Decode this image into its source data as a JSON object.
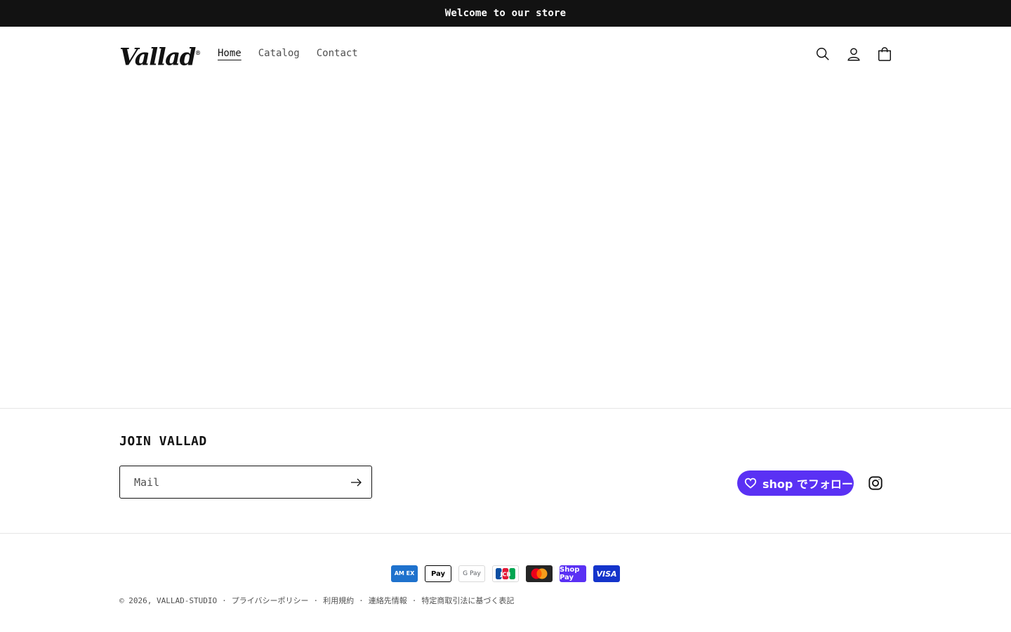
{
  "announcement": {
    "text": "Welcome to our store"
  },
  "header": {
    "logo_text": "Vallad",
    "logo_mark": "®",
    "nav": [
      {
        "label": "Home",
        "active": true
      },
      {
        "label": "Catalog",
        "active": false
      },
      {
        "label": "Contact",
        "active": false
      }
    ],
    "icons": [
      "search-icon",
      "account-icon",
      "cart-icon"
    ]
  },
  "footer": {
    "newsletter": {
      "title": "JOIN VALLAD",
      "placeholder": "Mail",
      "submit_icon": "arrow-right-icon"
    },
    "shop_follow": {
      "label": "shop でフォロー",
      "icon": "heart-icon"
    },
    "social": {
      "icon": "instagram-icon"
    },
    "payment_methods": [
      {
        "name": "American Express",
        "label": "AM EX"
      },
      {
        "name": "Apple Pay",
        "label": " Pay"
      },
      {
        "name": "Google Pay",
        "label": "G Pay"
      },
      {
        "name": "JCB",
        "label": "JCB"
      },
      {
        "name": "Mastercard",
        "label": ""
      },
      {
        "name": "Shop Pay",
        "label": "Shop Pay"
      },
      {
        "name": "Visa",
        "label": "VISA"
      }
    ],
    "copyright": "© 2026, VALLAD-STUDIO",
    "policy_links": [
      "プライバシーポリシー",
      "利用規約",
      "連絡先情報",
      "特定商取引法に基づく表記"
    ],
    "separator": "·"
  },
  "colors": {
    "announcement_bg": "#121212",
    "shop_purple": "#5a31f4",
    "text": "#121212"
  }
}
